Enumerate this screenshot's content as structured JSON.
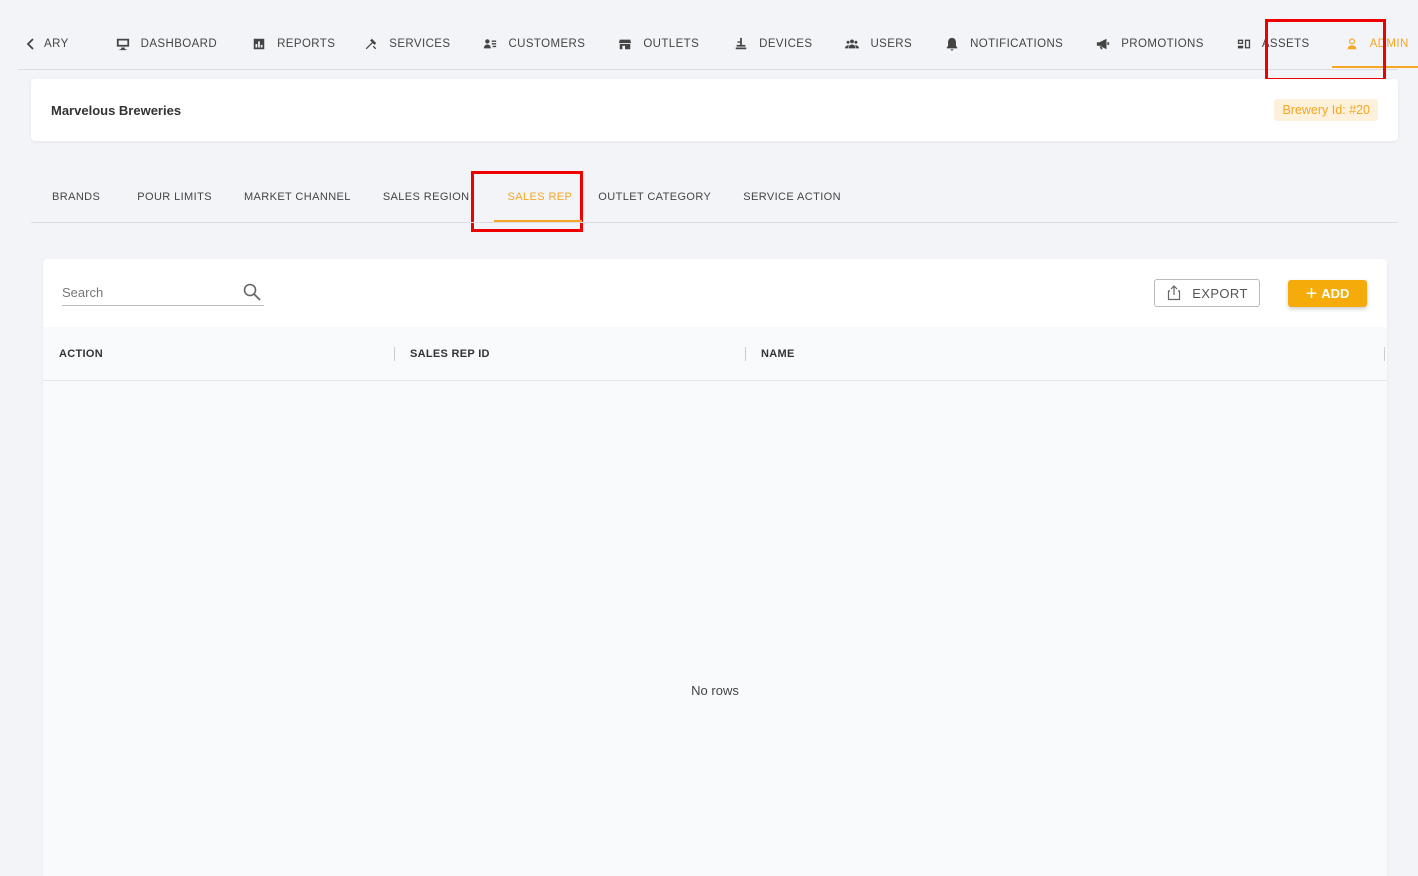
{
  "topnav": {
    "back_icon": "chevron-left-icon",
    "items": [
      {
        "label": "ARY",
        "icon": "none"
      },
      {
        "label": "DASHBOARD",
        "icon": "monitor-icon"
      },
      {
        "label": "REPORTS",
        "icon": "chart-icon"
      },
      {
        "label": "SERVICES",
        "icon": "tools-icon"
      },
      {
        "label": "CUSTOMERS",
        "icon": "customers-icon"
      },
      {
        "label": "OUTLETS",
        "icon": "store-icon"
      },
      {
        "label": "DEVICES",
        "icon": "tap-icon"
      },
      {
        "label": "USERS",
        "icon": "users-icon"
      },
      {
        "label": "NOTIFICATIONS",
        "icon": "bell-icon"
      },
      {
        "label": "PROMOTIONS",
        "icon": "megaphone-icon"
      },
      {
        "label": "ASSETS",
        "icon": "assets-icon"
      },
      {
        "label": "ADMIN",
        "icon": "admin-icon"
      }
    ],
    "active": "ADMIN"
  },
  "brewery": {
    "name": "Marvelous Breweries",
    "id_label": "Brewery Id: #20"
  },
  "subtabs": {
    "items": [
      "BRANDS",
      "POUR LIMITS",
      "MARKET CHANNEL",
      "SALES REGION",
      "SALES REP",
      "OUTLET CATEGORY",
      "SERVICE ACTION"
    ],
    "active": "SALES REP"
  },
  "toolbar": {
    "search_placeholder": "Search",
    "export_label": "EXPORT",
    "add_label": "ADD"
  },
  "table": {
    "columns": [
      "ACTION",
      "SALES REP ID",
      "NAME"
    ],
    "rows": [],
    "empty_text": "No rows"
  },
  "colors": {
    "accent": "#f5a623",
    "add_button": "#f5ac0a",
    "highlight": "#ee0000"
  }
}
